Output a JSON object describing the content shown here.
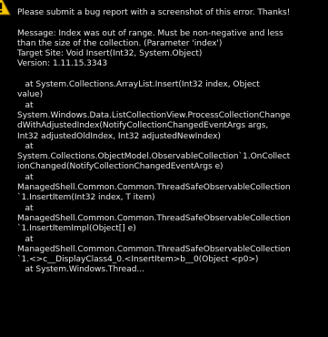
{
  "dialog": {
    "icon": "warning-icon",
    "header": "Please submit a bug report with a screenshot of this error. Thanks!",
    "message_lines": [
      "Message: Index was out of range. Must be non-negative and less",
      "than the size of the collection. (Parameter 'index')",
      "Target Site: Void Insert(Int32, System.Object)",
      "Version: 1.11.15.3343"
    ],
    "stack_lines": [
      "   at System.Collections.ArrayList.Insert(Int32 index, Object",
      "value)",
      "   at",
      "System.Windows.Data.ListCollectionView.ProcessCollectionChange",
      "dWithAdjustedIndex(NotifyCollectionChangedEventArgs args,",
      "Int32 adjustedOldIndex, Int32 adjustedNewIndex)",
      "   at",
      "System.Collections.ObjectModel.ObservableCollection`1.OnCollect",
      "ionChanged(NotifyCollectionChangedEventArgs e)",
      "   at",
      "ManagedShell.Common.Common.ThreadSafeObservableCollection",
      "`1.InsertItem(Int32 index, T item)",
      "   at",
      "ManagedShell.Common.Common.ThreadSafeObservableCollection",
      "`1.InsertItemImpl(Object[] e)",
      "   at",
      "ManagedShell.Common.Common.ThreadSafeObservableCollection",
      "`1.<>c__DisplayClass4_0.<InsertItem>b__0(Object <p0>)",
      "   at System.Windows.Thread..."
    ]
  },
  "colors": {
    "background": "#000000",
    "text": "#e6e6e6",
    "warning_fill": "#f5c400"
  }
}
